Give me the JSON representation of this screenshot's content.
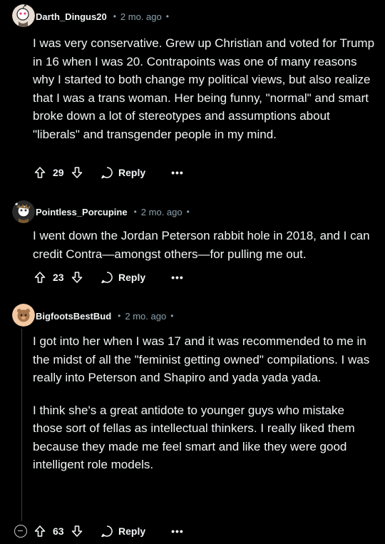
{
  "colors": {
    "background": "#000000",
    "text": "#f2f4f5",
    "meta": "#8ba2ad",
    "thread_line": "#3a3f41"
  },
  "comments": [
    {
      "username": "Darth_Dingus20",
      "separator": "•",
      "time": "2 mo. ago",
      "time_dot": "•",
      "avatar": "snoo-avatar-pink",
      "paragraphs": [
        "I was very conservative. Grew up Christian and voted for Trump in 16 when I was 20. Contrapoints was one of many reasons why I started to both change my political views, but also realize that I was a trans woman. Her being funny, \"normal\" and smart broke down a lot of stereotypes and assumptions about \"liberals\" and transgender people in my mind."
      ],
      "score": "29",
      "reply_label": "Reply",
      "more_label": "•••"
    },
    {
      "username": "Pointless_Porcupine",
      "separator": "•",
      "time": "2 mo. ago",
      "time_dot": "•",
      "avatar": "snoo-avatar-brown",
      "paragraphs": [
        "I went down the Jordan Peterson rabbit hole in 2018, and I can credit Contra—amongst others—for pulling me out."
      ],
      "score": "23",
      "reply_label": "Reply",
      "more_label": "•••"
    },
    {
      "username": "BigfootsBestBud",
      "separator": "•",
      "time": "2 mo. ago",
      "time_dot": "•",
      "avatar": "snoo-avatar-peach",
      "paragraphs": [
        "I got into her when I was 17 and it was recommended to me in the midst of all the \"feminist getting owned\" compilations. I was really into Peterson and Shapiro and yada yada yada.",
        "I think she's a great antidote to younger guys who mistake those sort of fellas as intellectual thinkers. I really liked them because they made me feel smart and like they were good intelligent role models."
      ],
      "score": "63",
      "reply_label": "Reply",
      "more_label": "•••"
    }
  ]
}
